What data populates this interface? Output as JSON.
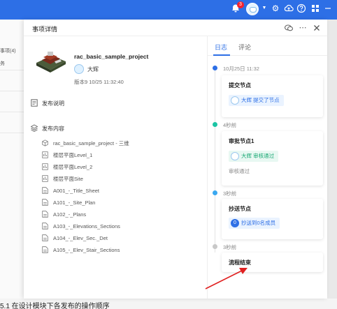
{
  "topbar": {
    "notification_count": "3"
  },
  "background": {
    "left_items": [
      "事项(4)",
      "务"
    ],
    "bottom_text": "5.1 在设计模块下各发布的操作顺序"
  },
  "drawer": {
    "title": "事项详情",
    "project_name": "rac_basic_sample_project",
    "owner": "大辉",
    "version": "版本9 10/25 11:32:40",
    "release_notes_label": "发布说明",
    "release_content_label": "发布内容",
    "files": [
      "rac_basic_sample_project - 三维",
      "楼层平面Level_1",
      "楼层平面Level_2",
      "楼层平面Site",
      "A001_-_Title_Sheet",
      "A101_-_Site_Plan",
      "A102_-_Plans",
      "A103_-_Elevations_Sections",
      "A104_-_Elev_Sec._Det",
      "A105_-_Elev_Stair_Sections"
    ]
  },
  "tabs": {
    "log": "日志",
    "comments": "评论"
  },
  "timeline": [
    {
      "time": "10月25日 11:32",
      "color": "#2d6fe6",
      "title": "提交节点",
      "chip": "大辉 提交了节点",
      "chip_style": "blue"
    },
    {
      "time": "4秒前",
      "color": "#1bc4a4",
      "title": "审批节点1",
      "chip": "大辉 审核通过",
      "chip_style": "green",
      "status": "审核通过"
    },
    {
      "time": "3秒前",
      "color": "#3aa8f0",
      "title": "抄送节点",
      "chip": "抄送到0名成员",
      "chip_num": "0",
      "chip_style": "blue"
    },
    {
      "time": "3秒前",
      "color": "#c8c8c8",
      "title": "流程结束"
    }
  ]
}
